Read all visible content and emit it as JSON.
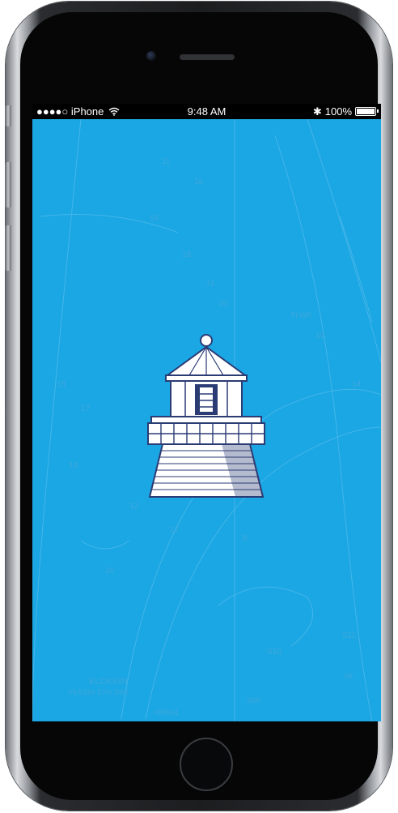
{
  "status_bar": {
    "signal": "●●●●○",
    "carrier": "iPhone",
    "wifi_icon": "wifi-icon",
    "time": "9:48 AM",
    "bluetooth": "✱",
    "battery": "100%"
  },
  "chart_labels": {
    "a": "KLOKKIN",
    "b": "Fl(4)20s 57m 20M",
    "c": "KMRA1",
    "d": "S11",
    "e": "S10",
    "f": "S6A",
    "g": "Fl WR",
    "h": "S8"
  },
  "colors": {
    "screen": "#1ba6e4",
    "logo_ink": "#2b3b74"
  }
}
